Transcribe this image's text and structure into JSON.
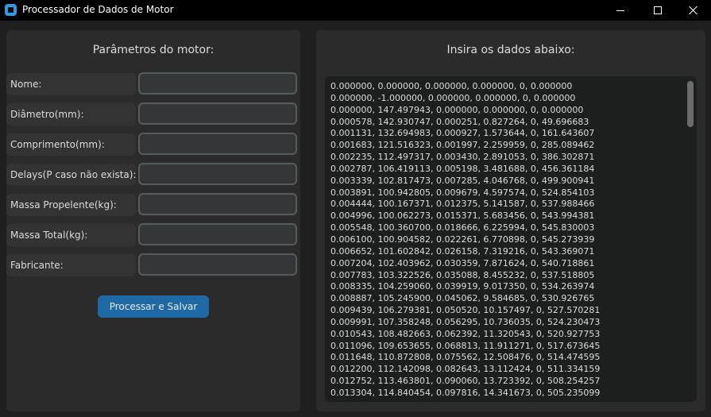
{
  "window": {
    "title": "Processador de Dados de Motor"
  },
  "left_panel": {
    "title": "Parâmetros do motor:",
    "fields": [
      {
        "label": "Nome:",
        "value": ""
      },
      {
        "label": "Diâmetro(mm):",
        "value": ""
      },
      {
        "label": "Comprimento(mm):",
        "value": ""
      },
      {
        "label": "Delays(P caso não exista):",
        "value": ""
      },
      {
        "label": "Massa Propelente(kg):",
        "value": ""
      },
      {
        "label": "Massa Total(kg):",
        "value": ""
      },
      {
        "label": "Fabricante:",
        "value": ""
      }
    ],
    "submit_label": "Processar e Salvar"
  },
  "right_panel": {
    "title": "Insira os dados abaixo:",
    "lines": [
      "0.000000, 0.000000, 0.000000, 0.000000, 0, 0.000000",
      "0.000000, -1.000000, 0.000000, 0.000000, 0, 0.000000",
      "0.000000, 147.497943, 0.000000, 0.000000, 0, 0.000000",
      "0.000578, 142.930747, 0.000251, 0.827264, 0, 49.696683",
      "0.001131, 132.694983, 0.000927, 1.573644, 0, 161.643607",
      "0.001683, 121.516323, 0.001997, 2.259959, 0, 285.089462",
      "0.002235, 112.497317, 0.003430, 2.891053, 0, 386.302871",
      "0.002787, 106.419113, 0.005198, 3.481688, 0, 456.361184",
      "0.003339, 102.817473, 0.007285, 4.046768, 0, 499.900941",
      "0.003891, 100.942805, 0.009679, 4.597574, 0, 524.854103",
      "0.004444, 100.167371, 0.012375, 5.141587, 0, 537.988466",
      "0.004996, 100.062273, 0.015371, 5.683456, 0, 543.994381",
      "0.005548, 100.360700, 0.018666, 6.225994, 0, 545.830003",
      "0.006100, 100.904582, 0.022261, 6.770898, 0, 545.273939",
      "0.006652, 101.602842, 0.026158, 7.319216, 0, 543.369071",
      "0.007204, 102.403962, 0.030359, 7.871624, 0, 540.718861",
      "0.007783, 103.322526, 0.035088, 8.455232, 0, 537.518805",
      "0.008335, 104.259060, 0.039919, 9.017350, 0, 534.263974",
      "0.008887, 105.245900, 0.045062, 9.584685, 0, 530.926765",
      "0.009439, 106.279381, 0.050520, 10.157497, 0, 527.570281",
      "0.009991, 107.358248, 0.056295, 10.736035, 0, 524.230473",
      "0.010543, 108.482663, 0.062392, 11.320543, 0, 520.927753",
      "0.011096, 109.653655, 0.068813, 11.911271, 0, 517.673645",
      "0.011648, 110.872808, 0.075562, 12.508476, 0, 514.474595",
      "0.012200, 112.142098, 0.082643, 13.112424, 0, 511.334159",
      "0.012752, 113.463801, 0.090060, 13.723392, 0, 508.254257",
      "0.013304, 114.840454, 0.097816, 14.341673, 0, 505.235099"
    ]
  },
  "colors": {
    "accent": "#1f6aa5",
    "panel": "#2b2b2b",
    "background": "#1f1f1f"
  }
}
